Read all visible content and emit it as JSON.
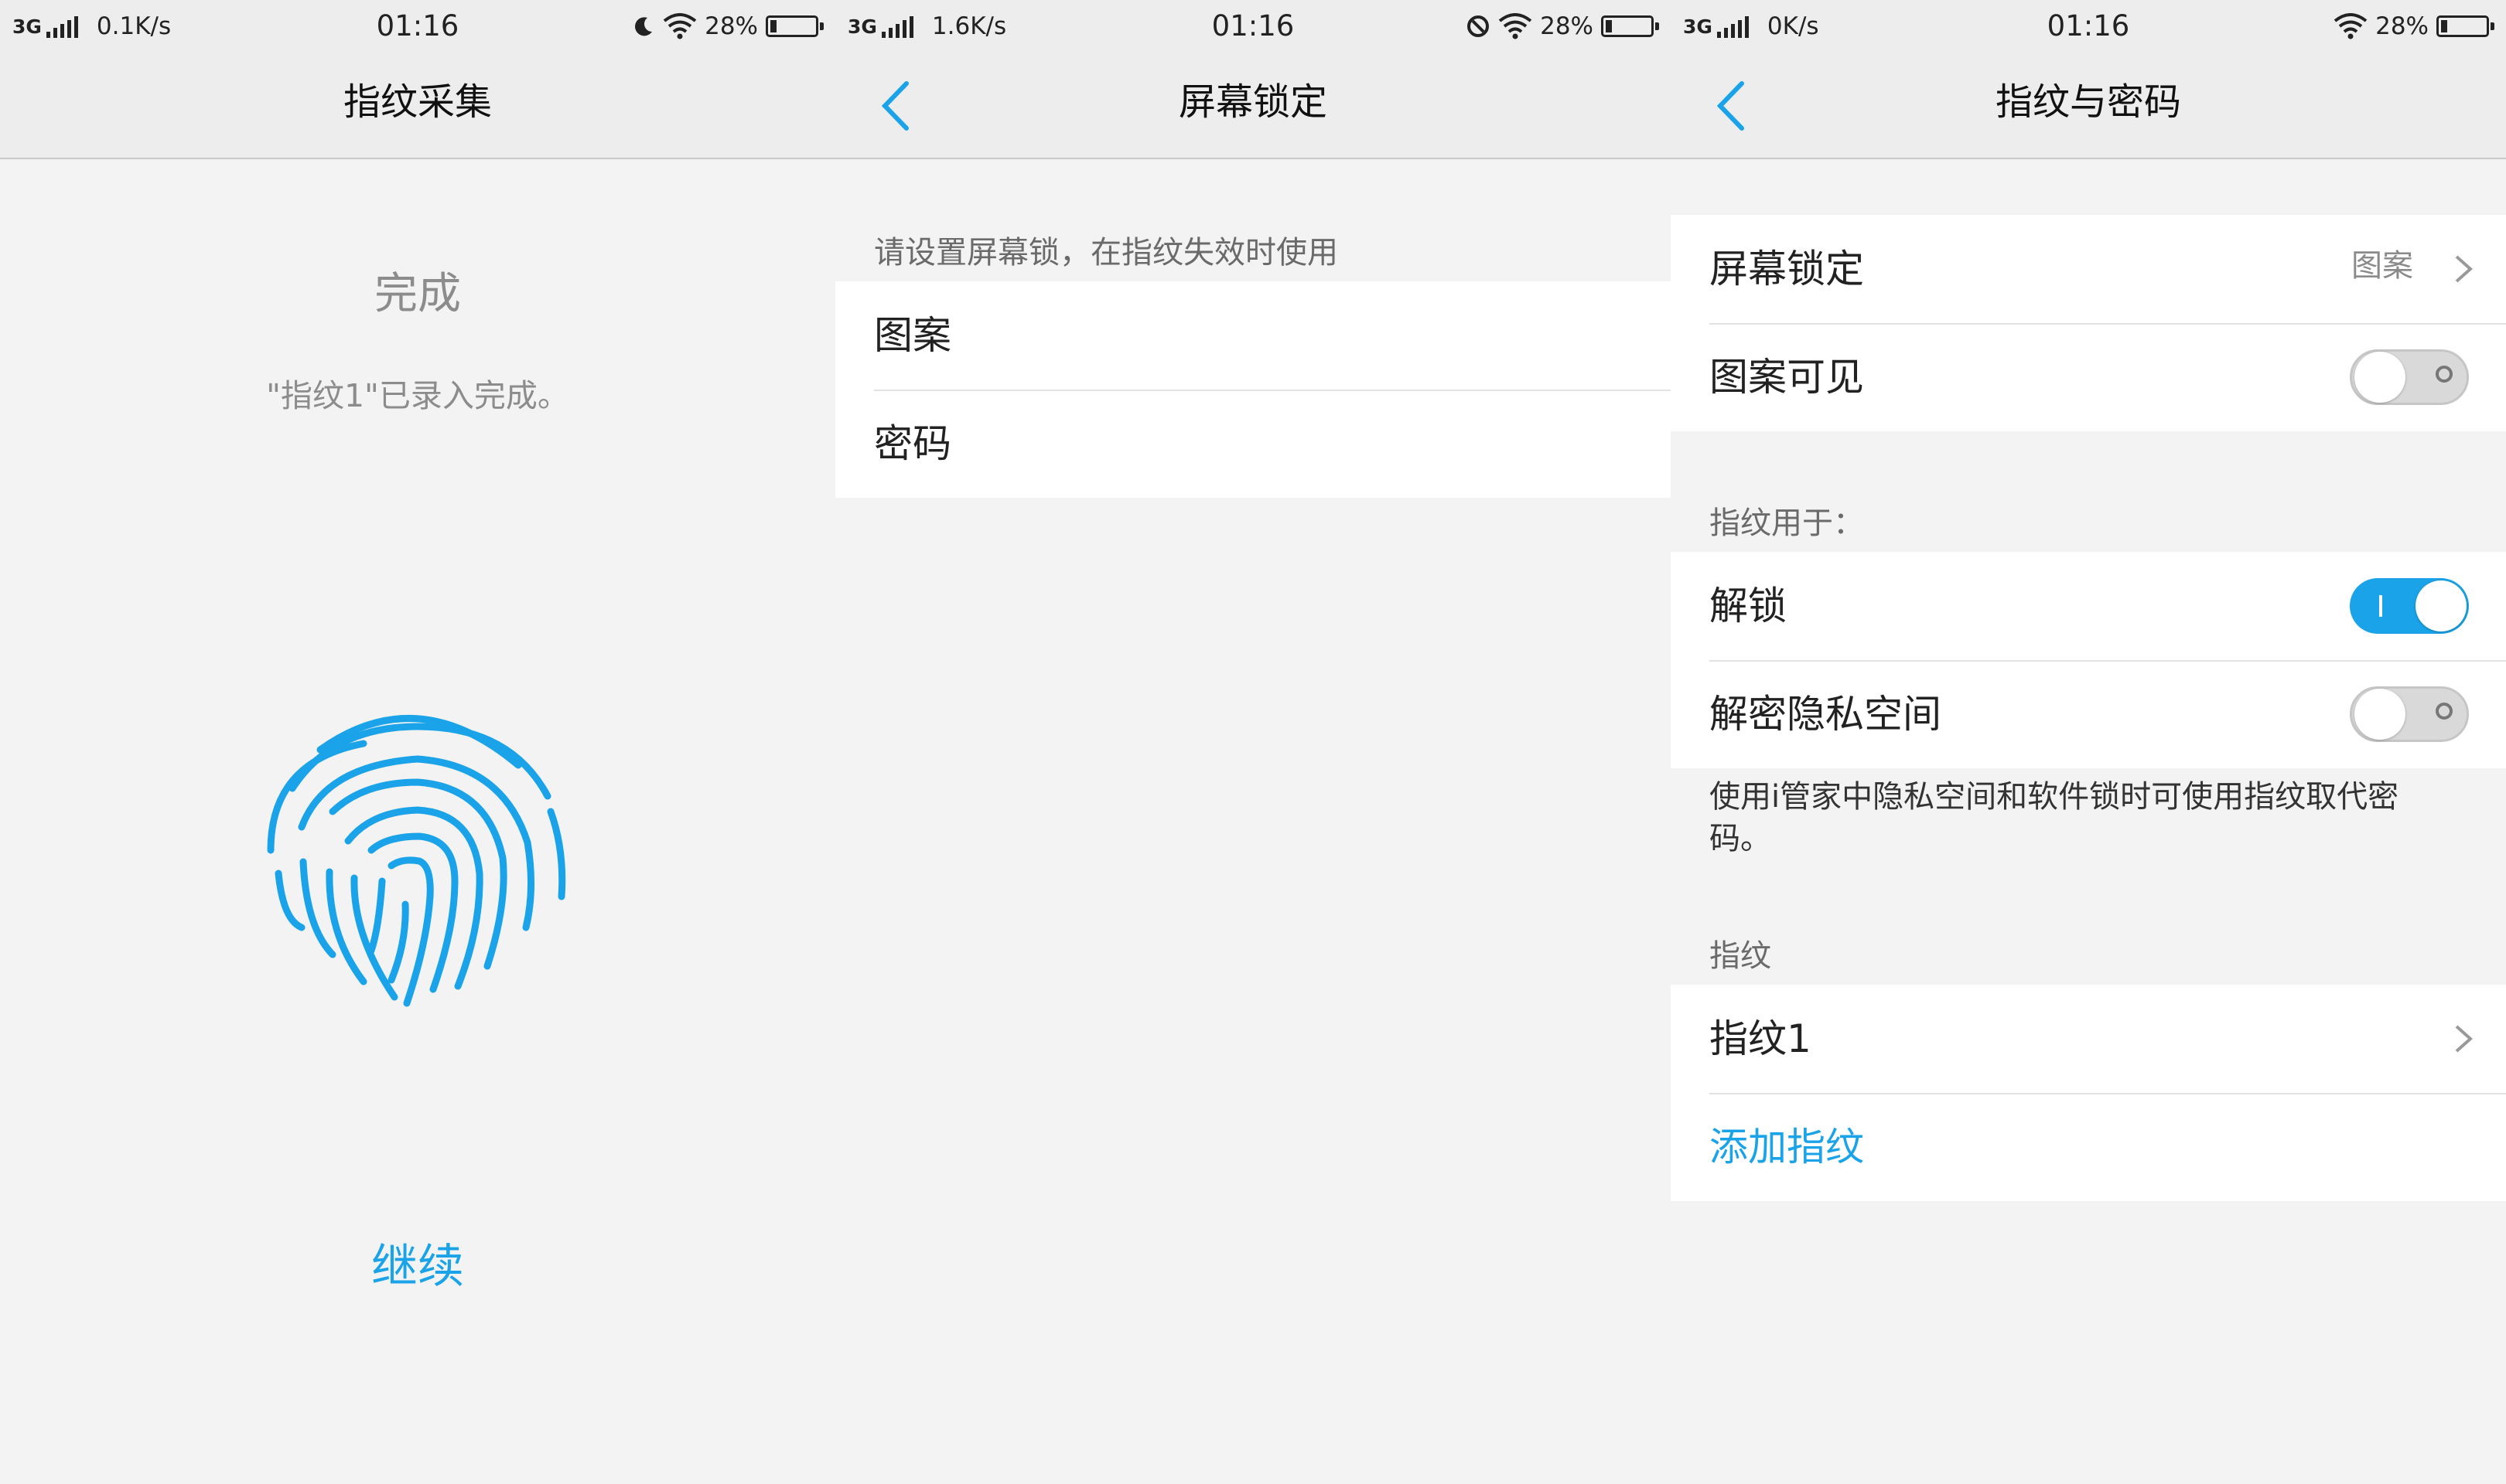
{
  "screens": [
    {
      "status": {
        "network": "3G",
        "speed": "0.1K/s",
        "time": "01:16",
        "battery": "28%"
      },
      "title": "指纹采集",
      "done_title": "完成",
      "done_sub": "\"指纹1\"已录入完成。",
      "continue": "继续"
    },
    {
      "status": {
        "network": "3G",
        "speed": "1.6K/s",
        "time": "01:16",
        "battery": "28%"
      },
      "title": "屏幕锁定",
      "hint": "请设置屏幕锁，在指纹失效时使用",
      "options": [
        "图案",
        "密码"
      ]
    },
    {
      "status": {
        "network": "3G",
        "speed": "0K/s",
        "time": "01:16",
        "battery": "28%"
      },
      "title": "指纹与密码",
      "screen_lock": {
        "label": "屏幕锁定",
        "value": "图案"
      },
      "pattern_visible": {
        "label": "图案可见",
        "on": false
      },
      "used_for_header": "指纹用于：",
      "unlock": {
        "label": "解锁",
        "on": true
      },
      "private_space": {
        "label": "解密隐私空间",
        "on": false
      },
      "note": "使用i管家中隐私空间和软件锁时可使用指纹取代密码。",
      "fingerprint_header": "指纹",
      "fingerprint_item": "指纹1",
      "add_fingerprint": "添加指纹"
    }
  ],
  "colors": {
    "accent": "#1aa3e8",
    "bar": "#ededed",
    "background": "#f3f3f3"
  }
}
